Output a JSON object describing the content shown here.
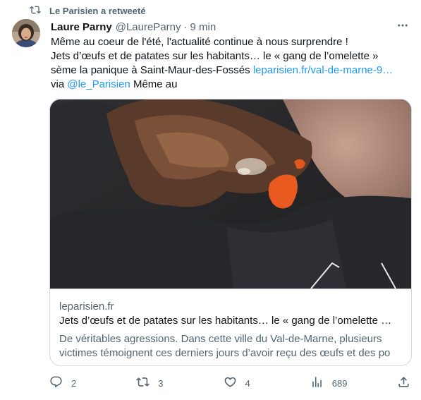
{
  "retweet": {
    "icon": "retweet-icon",
    "label": "Le Parisien a retweeté"
  },
  "author": {
    "avatar": "avatar",
    "name": "Laure Parny",
    "handle": "@LaureParny",
    "separator": "·",
    "time": "9 min"
  },
  "more_icon": "more-dots-icon",
  "tweet": {
    "line1": "Même au coeur de l'été, l'actualité continue à nous surprendre !",
    "line2": "Jets d’œufs et de patates sur les habitants… le « gang de l’omelette »",
    "line3_text": "sème la panique à Saint-Maur-des-Fossés ",
    "line3_link": "leparisien.fr/val-de-marne-9…",
    "line4_prefix": "via ",
    "line4_mention": "@le_Parisien",
    "line4_suffix": " Même au"
  },
  "card": {
    "domain": "leparisien.fr",
    "title": "Jets d’œufs et de patates sur les habitants… le « gang de l’omelette …",
    "desc_line1": "De véritables agressions. Dans cette ville du Val-de-Marne, plusieurs",
    "desc_line2": "victimes témoignent ces derniers jours d’avoir reçu des œufs et des po"
  },
  "actions": {
    "reply": {
      "icon": "reply-icon",
      "count": "2"
    },
    "retweet": {
      "icon": "retweet-icon",
      "count": "3"
    },
    "like": {
      "icon": "heart-icon",
      "count": "4"
    },
    "views": {
      "icon": "analytics-icon",
      "count": "689"
    },
    "share": {
      "icon": "share-icon"
    }
  },
  "colors": {
    "link": "#1d9bf0",
    "secondary_text": "#536471",
    "border": "#cfd9de"
  }
}
